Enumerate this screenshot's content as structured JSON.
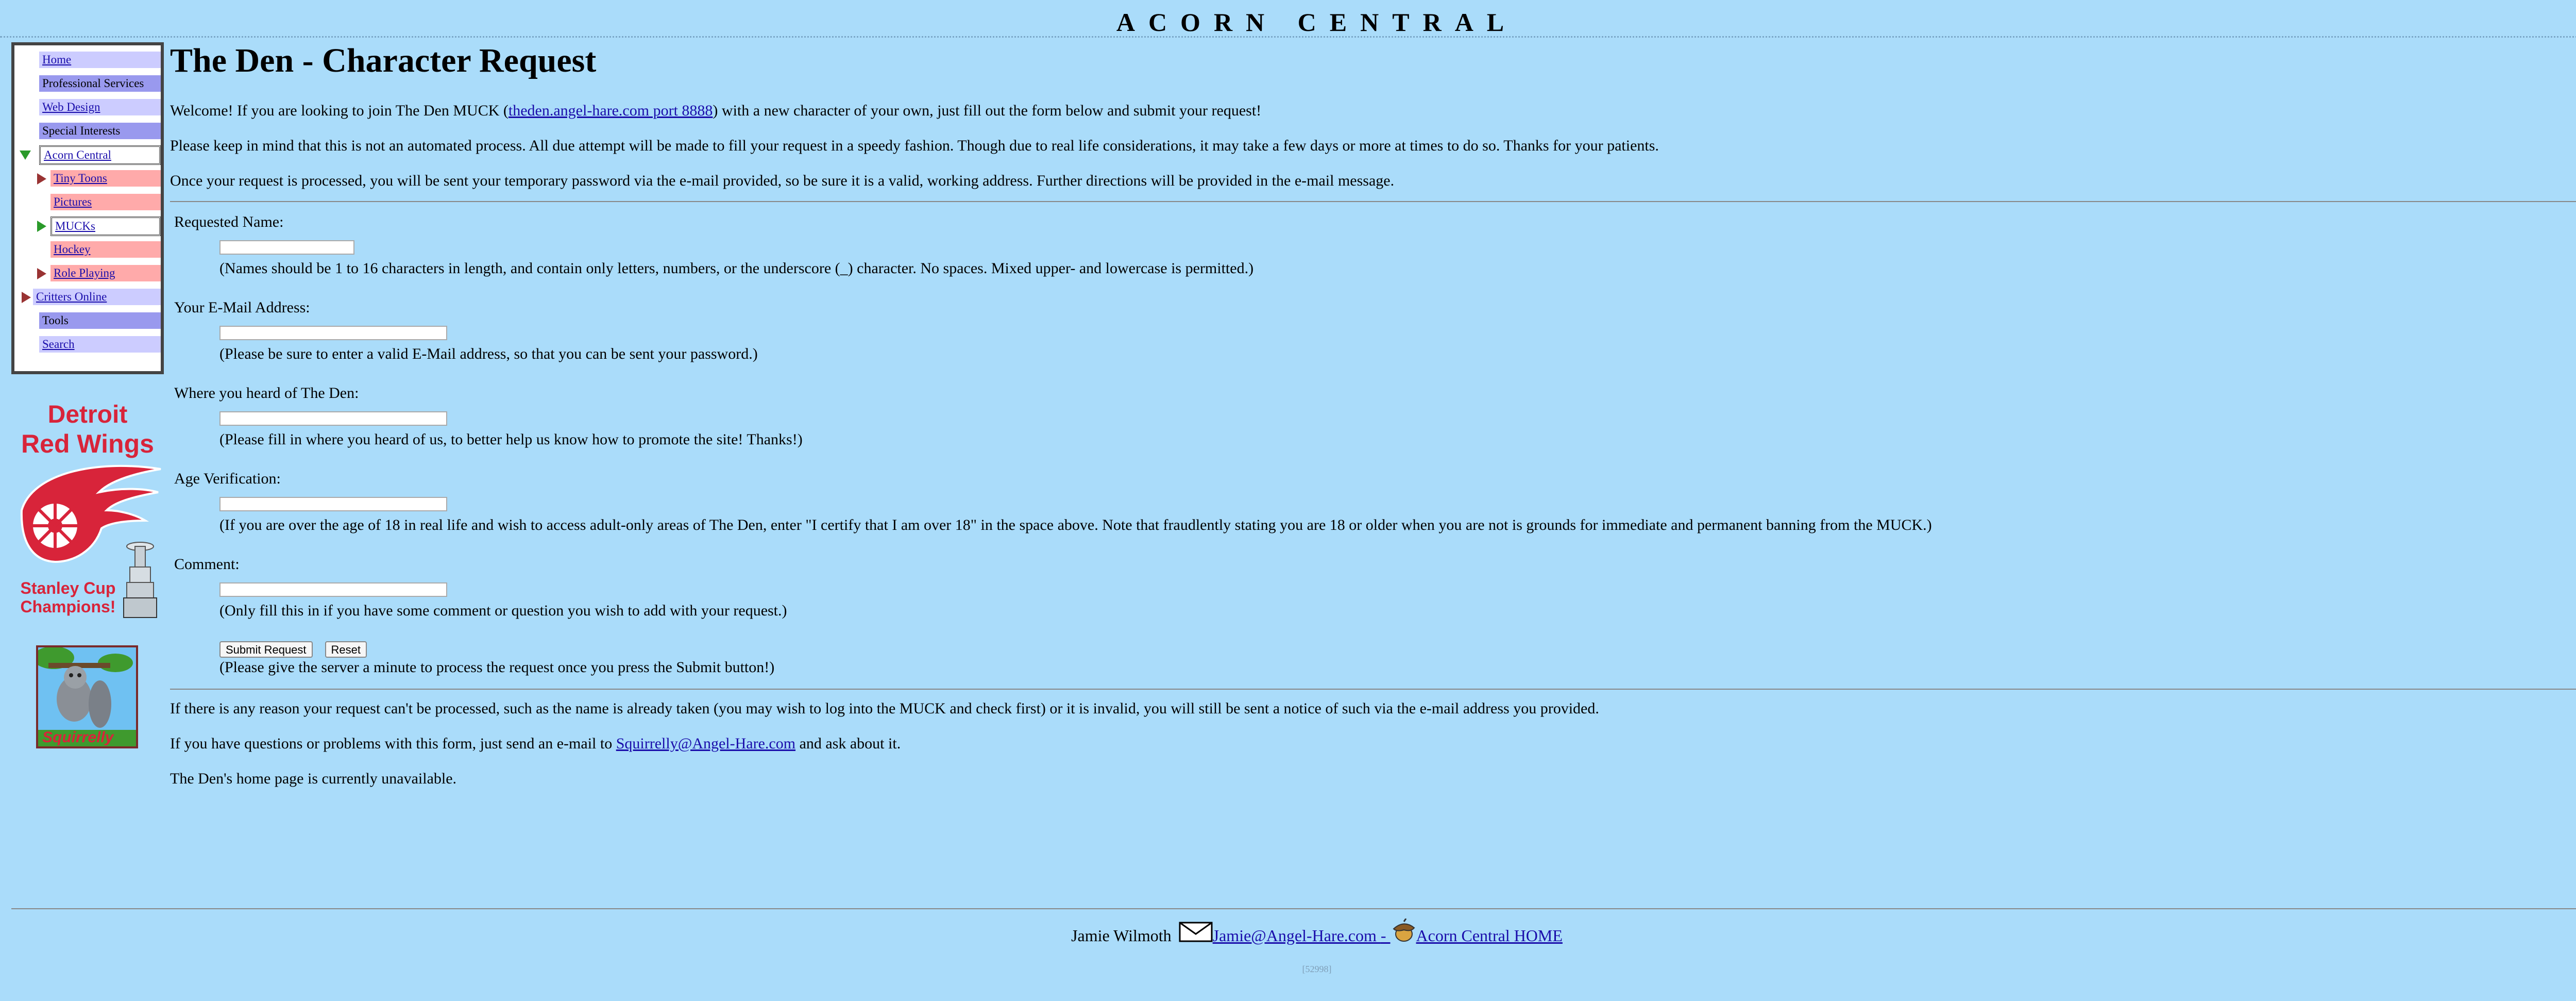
{
  "site_title": "ACORN CENTRAL",
  "nav": {
    "items": [
      {
        "label": "Home",
        "linked": true
      },
      {
        "label": "Professional Services",
        "linked": false
      },
      {
        "label": "Web Design",
        "linked": true
      },
      {
        "label": "Special Interests",
        "linked": false
      },
      {
        "label": "Acorn Central",
        "linked": true
      },
      {
        "label": "Tiny Toons",
        "linked": true
      },
      {
        "label": "Pictures",
        "linked": true
      },
      {
        "label": "MUCKs",
        "linked": true
      },
      {
        "label": "Hockey",
        "linked": true
      },
      {
        "label": "Role Playing",
        "linked": true
      },
      {
        "label": "Critters Online",
        "linked": true
      },
      {
        "label": "Tools",
        "linked": false
      },
      {
        "label": "Search",
        "linked": true
      }
    ]
  },
  "logos": {
    "wings_line1": "Detroit",
    "wings_line2": "Red Wings",
    "wings_line3": "Stanley Cup",
    "wings_line4": "Champions!",
    "squirrelly": "Squirrelly"
  },
  "page": {
    "title": "The Den - Character Request",
    "intro": {
      "before_link": "Welcome! If you are looking to join The Den MUCK (",
      "link": "theden.angel-hare.com port 8888",
      "after_link": ") with a new character of your own, just fill out the form below and submit your request!"
    },
    "para2": "Please keep in mind that this is not an automated process. All due attempt will be made to fill your request in a speedy fashion. Though due to real life considerations, it may take a few days or more at times to do so. Thanks for your patients.",
    "para3": "Once your request is processed, you will be sent your temporary password via the e-mail provided, so be sure it is a valid, working address. Further directions will be provided in the e-mail message."
  },
  "form": {
    "name_label": "Requested Name:",
    "name_note": "(Names should be 1 to 16 characters in length, and contain only letters, numbers, or the underscore (_) character. No spaces. Mixed upper- and lowercase is permitted.)",
    "email_label": "Your E-Mail Address:",
    "email_note": "(Please be sure to enter a valid E-Mail address, so that you can be sent your password.)",
    "heard_label": "Where you heard of The Den:",
    "heard_note": "(Please fill in where you heard of us, to better help us know how to promote the site! Thanks!)",
    "age_label": "Age Verification:",
    "age_note": "(If you are over the age of 18 in real life and wish to access adult-only areas of The Den, enter \"I certify that I am over 18\" in the space above. Note that fraudlently stating you are 18 or older when you are not is grounds for immediate and permanent banning from the MUCK.)",
    "comment_label": "Comment:",
    "comment_note": "(Only fill this in if you have some comment or question you wish to add with your request.)",
    "submit_label": "Submit Request",
    "reset_label": "Reset",
    "submit_note": "(Please give the server a minute to process the request once you press the Submit button!)"
  },
  "after": {
    "para1": "If there is any reason your request can't be processed, such as the name is already taken (you may wish to log into the MUCK and check first) or it is invalid, you will still be sent a notice of such via the e-mail address you provided.",
    "para2_before": "If you have questions or problems with this form, just send an e-mail to ",
    "para2_link": "Squirrelly@Angel-Hare.com",
    "para2_after": " and ask about it.",
    "para3": "The Den's home page is currently unavailable."
  },
  "footer": {
    "name": "Jamie Wilmoth",
    "email": "Jamie@Angel-Hare.com ",
    "separator": "- ",
    "home_link": "Acorn Central HOME ",
    "counter": "[52998]"
  },
  "icons": {
    "email": "envelope-icon",
    "acorn": "acorn-icon",
    "expanded": "green-triangle-down-icon",
    "collapsed": "triangle-right-icon"
  }
}
